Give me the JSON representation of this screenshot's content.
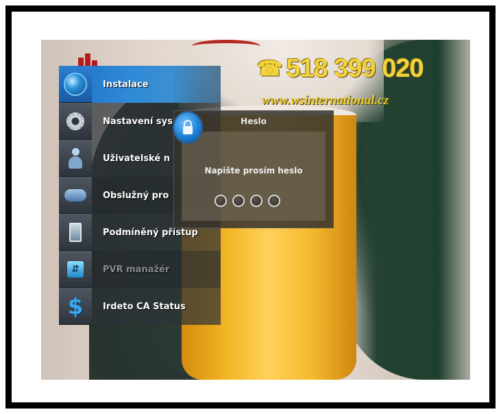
{
  "overlay": {
    "phone": "518 399 020",
    "website": "www.wsinternational.cz"
  },
  "menu": {
    "items": [
      {
        "label": "Instalace",
        "icon": "globe-icon",
        "state": "selected"
      },
      {
        "label": "Nastavení sys",
        "icon": "gear-icon",
        "state": "normal"
      },
      {
        "label": "Uživatelské n",
        "icon": "user-icon",
        "state": "normal"
      },
      {
        "label": "Obslužný pro",
        "icon": "gamepad-icon",
        "state": "normal"
      },
      {
        "label": "Podmíněný přístup",
        "icon": "smartcard-icon",
        "state": "normal"
      },
      {
        "label": "PVR manažér",
        "icon": "usb-icon",
        "state": "disabled"
      },
      {
        "label": "Irdeto CA Status",
        "icon": "dollar-icon",
        "state": "normal"
      }
    ]
  },
  "dialog": {
    "title": "Heslo",
    "message": "Napište prosím heslo",
    "pin_slots": 4,
    "icon": "lock-icon"
  },
  "colors": {
    "selected": "#2f8ad8",
    "overlay_text": "#f3d23c"
  }
}
